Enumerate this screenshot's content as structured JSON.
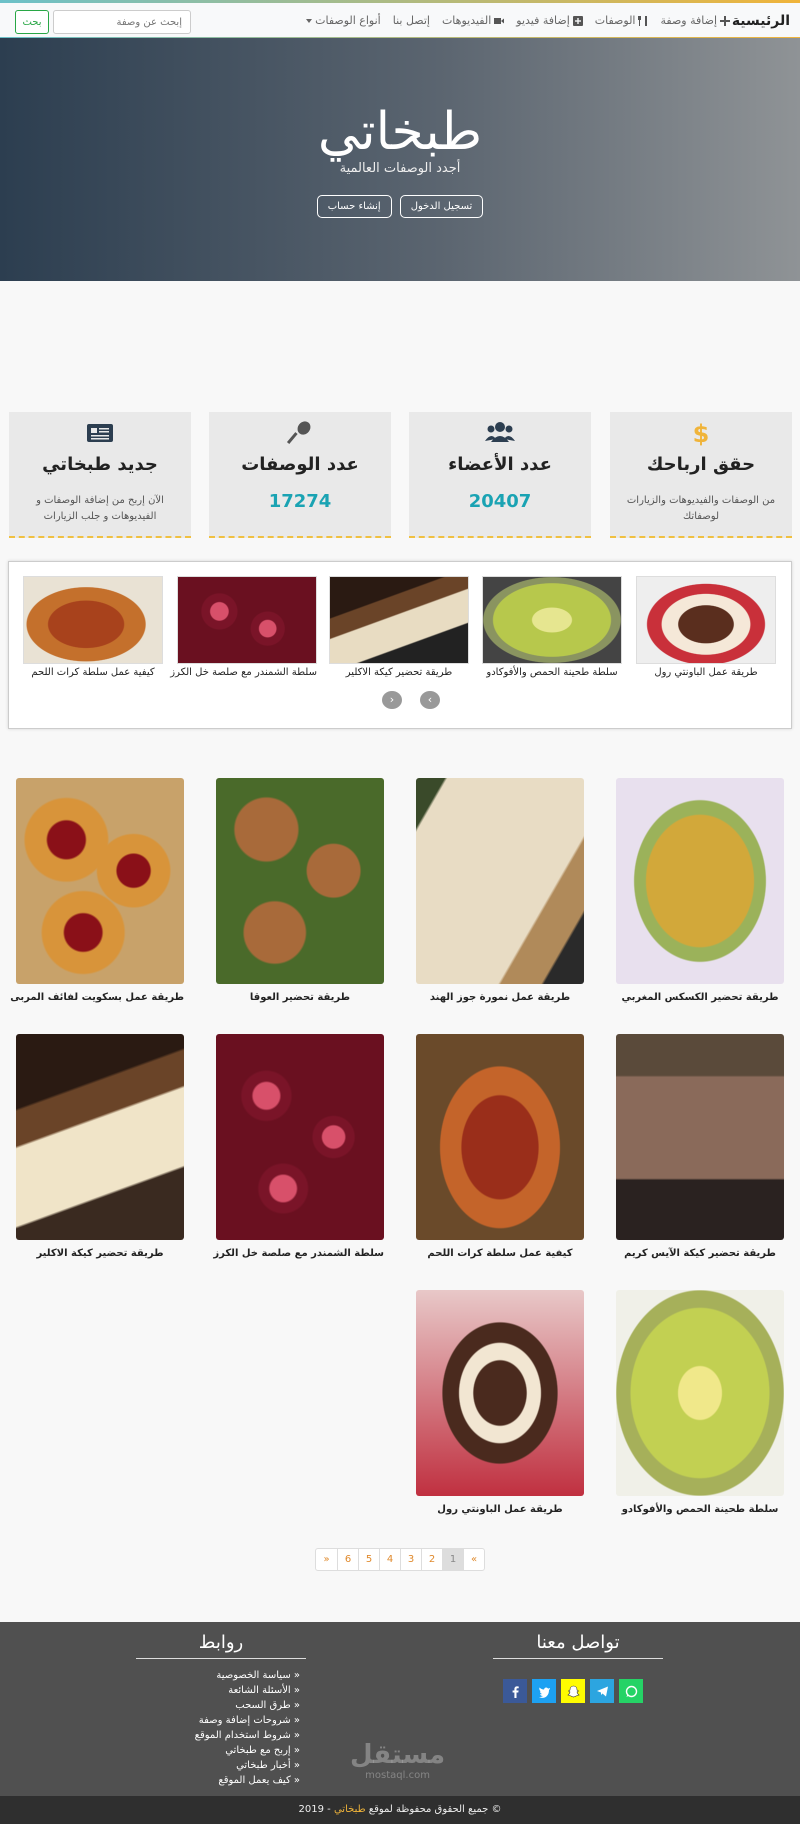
{
  "navbar": {
    "brand": "الرئيسية",
    "links": [
      {
        "label": "إضافة وصفة",
        "icon": "plus-icon"
      },
      {
        "label": "الوصفات",
        "icon": "utensils-icon"
      },
      {
        "label": "إضافة فيديو",
        "icon": "plus-square-icon"
      },
      {
        "label": "الفيديوهات",
        "icon": "video-icon"
      },
      {
        "label": "إتصل بنا",
        "icon": ""
      },
      {
        "label": "أنواع الوصفات",
        "icon": "caret-down-icon"
      }
    ],
    "search_placeholder": "إبحث عن وصفة",
    "search_button": "بحث"
  },
  "hero": {
    "title": "طبخاتي",
    "subtitle": "أجدد الوصفات العالمية",
    "login": "تسجيل الدخول",
    "register": "إنشاء حساب"
  },
  "stats": [
    {
      "title": "حقق ارباحك",
      "desc": "من الوصفات والفيديوهات والزيارات لوصفاتك",
      "value": "",
      "icon": "dollar-icon"
    },
    {
      "title": "عدد الأعضاء",
      "desc": "",
      "value": "20407",
      "icon": "users-icon"
    },
    {
      "title": "عدد الوصفات",
      "desc": "",
      "value": "17274",
      "icon": "spoon-icon"
    },
    {
      "title": "جديد طبخاتي",
      "desc": "الآن إربح من إضافة الوصفات و الفيديوهات و جلب الزيارات",
      "value": "",
      "icon": "newspaper-icon"
    }
  ],
  "carousel": [
    "طريقة عمل الباونتي رول",
    "سلطة طحينة الحمص والأفوكادو",
    "طريقة تحضير كيكة الاكلير",
    "سلطة الشمندر مع صلصة خل الكرز",
    "كيفية عمل سلطة كرات اللحم"
  ],
  "grid": [
    "طريقة تحضير الكسكس المغربي",
    "طريقة عمل نمورة جوز الهند",
    "طريقة تحضير العوقا",
    "طريقة عمل بسكويت لفائف المربى",
    "طريقة تحضير كيكة الآيس كريم",
    "كيفية عمل سلطة كرات اللحم",
    "سلطة الشمندر مع صلصة خل الكرز",
    "طريقة تحضير كيكة الاكلير",
    "سلطة طحينة الحمص والأفوكادو",
    "طريقة عمل الباونتي رول"
  ],
  "pagination": [
    "»",
    "1",
    "2",
    "3",
    "4",
    "5",
    "6",
    "«"
  ],
  "footer": {
    "contact_title": "تواصل معنا",
    "links_title": "روابط",
    "links": [
      "سياسة الخصوصية",
      "الأسئلة الشائعة",
      "طرق السحب",
      "شروحات إضافة وصفة",
      "شروط استخدام الموقع",
      "إربح مع طبخاتي",
      "أخبار طبخاتي",
      "كيف يعمل الموقع"
    ],
    "social": [
      "facebook-icon",
      "twitter-icon",
      "snapchat-icon",
      "telegram-icon",
      "whatsapp-icon"
    ],
    "watermark_big": "مستقل",
    "watermark_small": "mostaql.com",
    "copyright_pre": "© جميع الحقوق محفوظة لموقع",
    "copyright_site": "طبخاتي",
    "copyright_year": "- 2019"
  },
  "colors": {
    "accent": "#1aa3b3",
    "brand": "#f0b43a",
    "footer": "#505050"
  }
}
